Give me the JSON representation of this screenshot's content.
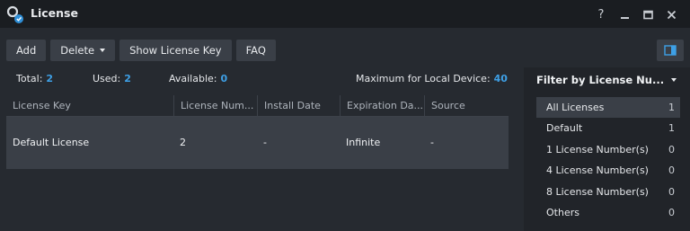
{
  "window": {
    "title": "License",
    "icon": "key-badge-icon"
  },
  "controls": {
    "help": "?",
    "minimize": "minimize-icon",
    "maximize": "maximize-icon",
    "close": "close-icon"
  },
  "toolbar": {
    "add_label": "Add",
    "delete_label": "Delete",
    "show_key_label": "Show License Key",
    "faq_label": "FAQ",
    "panel_toggle_icon": "panel-toggle-icon"
  },
  "stats": {
    "total_label": "Total:",
    "total_value": "2",
    "used_label": "Used:",
    "used_value": "2",
    "available_label": "Available:",
    "available_value": "0",
    "max_label": "Maximum for Local Device:",
    "max_value": "40"
  },
  "table": {
    "columns": [
      "License Key",
      "License Num...",
      "Install Date",
      "Expiration Da...",
      "Source"
    ],
    "rows": [
      {
        "key": "Default License",
        "number": "2",
        "install_date": "-",
        "expiration": "Infinite",
        "source": "-"
      }
    ]
  },
  "filter": {
    "title": "Filter by License Nu...",
    "items": [
      {
        "label": "All Licenses",
        "count": "1",
        "selected": true
      },
      {
        "label": "Default",
        "count": "1"
      },
      {
        "label": "1 License Number(s)",
        "count": "0"
      },
      {
        "label": "4 License Number(s)",
        "count": "0"
      },
      {
        "label": "8 License Number(s)",
        "count": "0"
      },
      {
        "label": "Others",
        "count": "0"
      }
    ]
  },
  "colors": {
    "accent": "#3ea0e6",
    "selected_row": "#3a3f47",
    "background": "#262a30"
  }
}
